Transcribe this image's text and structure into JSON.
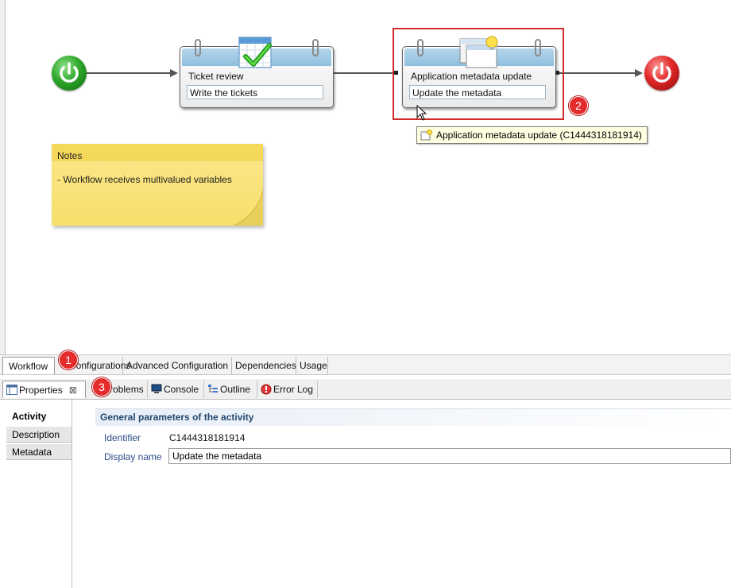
{
  "workflow": {
    "activities": [
      {
        "title": "Ticket review",
        "field": "Write the tickets"
      },
      {
        "title": "Application metadata update",
        "field": "Update the metadata"
      }
    ],
    "tooltip": "Application metadata update (C1444318181914)",
    "notes": {
      "title": "Notes",
      "body": "- Workflow receives multivalued variables"
    }
  },
  "annotations": [
    "1",
    "2",
    "3"
  ],
  "editor_tabs": [
    "Workflow",
    "Configurations",
    "Advanced Configuration",
    "Dependencies",
    "Usage"
  ],
  "view_tabs": [
    "Properties",
    "Problems",
    "Console",
    "Outline",
    "Error Log"
  ],
  "properties": {
    "side_tabs": [
      "Activity",
      "Description",
      "Metadata"
    ],
    "section_title": "General parameters of the activity",
    "identifier_label": "Identifier",
    "identifier_value": "C1444318181914",
    "display_name_label": "Display name",
    "display_name_value": "Update the metadata"
  },
  "colors": {
    "accent_red": "#d12b2b",
    "start_green": "#2ea82a",
    "end_red": "#e12727",
    "notes_yellow": "#f8df6c",
    "section_blue": "#24466f"
  }
}
